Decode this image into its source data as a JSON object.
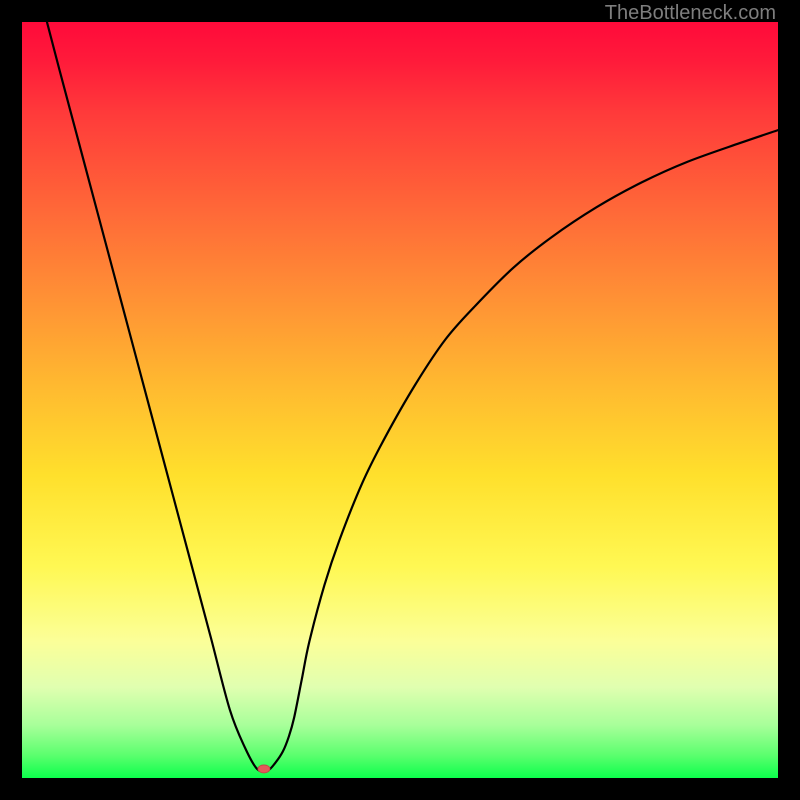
{
  "branding": "TheBottleneck.com",
  "chart_data": {
    "type": "line",
    "title": "",
    "xlabel": "",
    "ylabel": "",
    "xlim": [
      0,
      100
    ],
    "ylim": [
      0,
      100
    ],
    "x": [
      3.3,
      5,
      7,
      9,
      11,
      13,
      15,
      17,
      19,
      21,
      23,
      25,
      27.5,
      29.5,
      31.1,
      32.5,
      33.5,
      34.5,
      35.3,
      36,
      37,
      38,
      40,
      42,
      45,
      48,
      52,
      56,
      60,
      65,
      70,
      76,
      82,
      88,
      95,
      100
    ],
    "y": [
      100,
      93.5,
      86,
      78.5,
      71,
      63.5,
      56,
      48.5,
      41,
      33.5,
      26,
      18.5,
      9,
      4,
      1.2,
      1,
      2,
      3.5,
      5.5,
      8,
      13,
      18,
      25.5,
      31.5,
      39,
      45,
      52,
      58,
      62.5,
      67.5,
      71.5,
      75.5,
      78.8,
      81.5,
      84,
      85.7
    ],
    "marker": {
      "x": 32,
      "y": 1.2,
      "color": "#e35a5a",
      "size": 8
    },
    "grid": false,
    "legend": false,
    "background_gradient": {
      "direction": "vertical",
      "stops": [
        {
          "pos": 0,
          "color": "#ff0a3a"
        },
        {
          "pos": 0.25,
          "color": "#ff6b38"
        },
        {
          "pos": 0.5,
          "color": "#ffc52e"
        },
        {
          "pos": 0.75,
          "color": "#fbff6a"
        },
        {
          "pos": 1.0,
          "color": "#0cff4c"
        }
      ]
    }
  }
}
